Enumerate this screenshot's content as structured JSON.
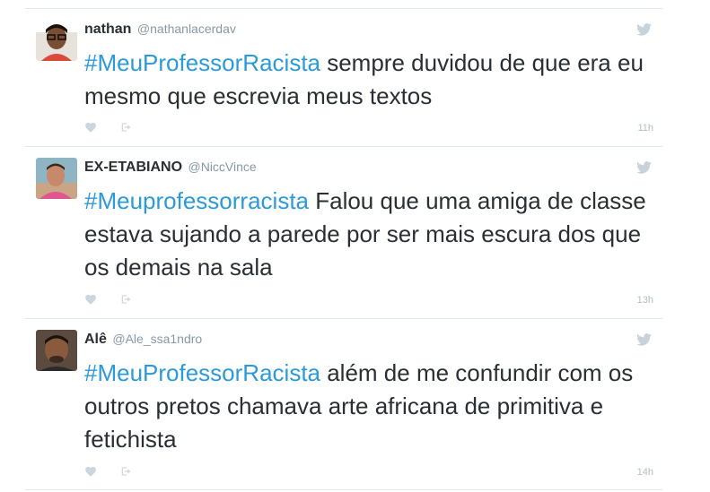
{
  "icons": {
    "bird": "twitter-bird-icon",
    "like": "heart-icon",
    "share": "share-icon"
  },
  "colors": {
    "hashtag": "#2b9ad8",
    "divider": "#e1e8ed",
    "muted": "#8899a6",
    "icon": "#ccd6dd"
  },
  "tweets": [
    {
      "name": "nathan",
      "handle": "@nathanlacerdav",
      "hashtag": "#MeuProfessorRacista",
      "text": " sempre duvidou de que era eu mesmo que escrevia meus textos",
      "time": "11h"
    },
    {
      "name": "EX-ETABIANO",
      "handle": "@NiccVince",
      "hashtag": "#Meuprofessorracista",
      "text": " Falou que uma amiga de classe estava sujando a parede por ser mais escura dos que os demais na sala",
      "time": "13h"
    },
    {
      "name": "Alê",
      "handle": "@Ale_ssa1ndro",
      "hashtag": "#MeuProfessorRacista",
      "text": " além de me confundir com os outros pretos chamava arte africana de primitiva e fetichista",
      "time": "14h"
    }
  ]
}
